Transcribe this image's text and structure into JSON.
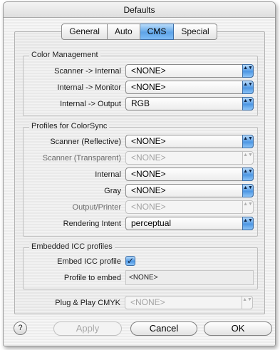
{
  "window": {
    "title": "Defaults"
  },
  "tabs": [
    {
      "label": "General",
      "active": false
    },
    {
      "label": "Auto",
      "active": false
    },
    {
      "label": "CMS",
      "active": true
    },
    {
      "label": "Special",
      "active": false
    }
  ],
  "color_management": {
    "title": "Color Management",
    "rows": [
      {
        "label": "Scanner -> Internal",
        "value": "<NONE>",
        "enabled": true
      },
      {
        "label": "Internal -> Monitor",
        "value": "<NONE>",
        "enabled": true
      },
      {
        "label": "Internal -> Output",
        "value": "RGB",
        "enabled": true
      }
    ]
  },
  "colorsync": {
    "title": "Profiles for ColorSync",
    "rows": [
      {
        "label": "Scanner (Reflective)",
        "value": "<NONE>",
        "enabled": true
      },
      {
        "label": "Scanner (Transparent)",
        "value": "<NONE>",
        "enabled": false
      },
      {
        "label": "Internal",
        "value": "<NONE>",
        "enabled": true
      },
      {
        "label": "Gray",
        "value": "<NONE>",
        "enabled": true
      },
      {
        "label": "Output/Printer",
        "value": "<NONE>",
        "enabled": false
      },
      {
        "label": "Rendering Intent",
        "value": "perceptual",
        "enabled": true
      }
    ]
  },
  "embedded": {
    "title": "Embedded ICC profiles",
    "embed_label": "Embed ICC profile",
    "embed_checked": true,
    "checkmark": "✓",
    "profile_label": "Profile to embed",
    "profile_value": "<NONE>"
  },
  "plug_and_play": {
    "label": "Plug & Play CMYK",
    "value": "<NONE>",
    "enabled": false
  },
  "buttons": {
    "help": "?",
    "apply": "Apply",
    "cancel": "Cancel",
    "ok": "OK"
  },
  "popup_arrows": "▲▼",
  "colors": {
    "accent": "#5ea4e8",
    "accent_dark": "#3f6fa6"
  }
}
